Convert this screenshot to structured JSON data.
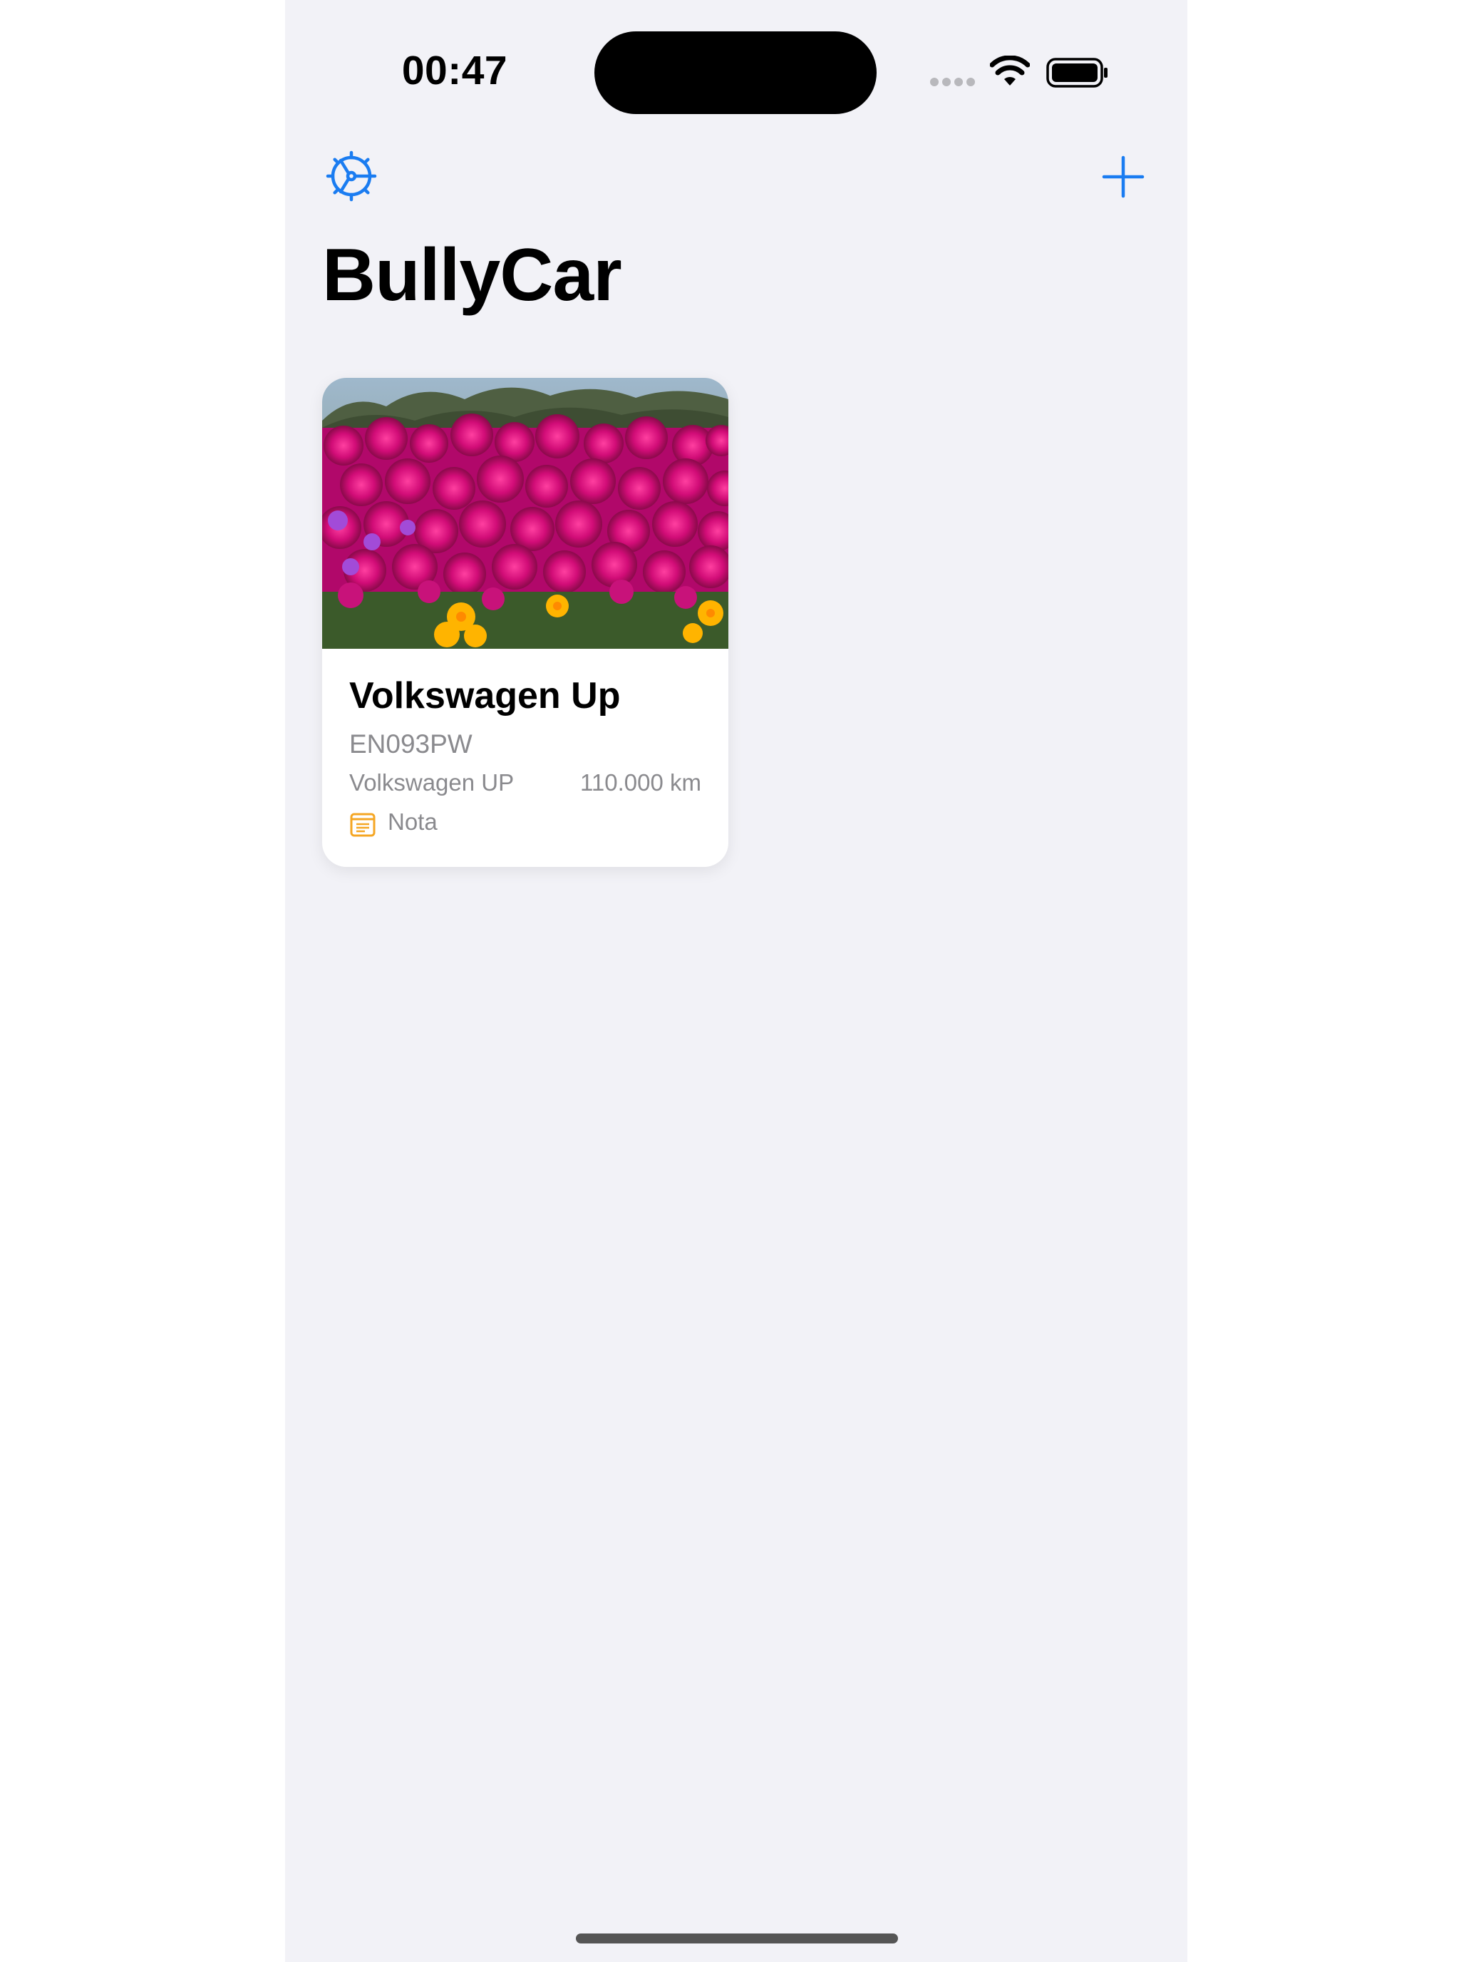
{
  "status_bar": {
    "time": "00:47"
  },
  "nav": {
    "settings_icon": "gear-steering-wheel-icon",
    "add_icon": "plus-icon",
    "title": "BullyCar"
  },
  "colors": {
    "accent": "#1a7cf1",
    "background": "#f2f2f7",
    "secondary_text": "#8a8a8e",
    "note_icon": "#f5a623"
  },
  "cars": [
    {
      "name": "Volkswagen Up",
      "plate": "EN093PW",
      "model": "Volkswagen UP",
      "mileage": "110.000 km",
      "note_label": "Nota",
      "photo": "flower-field-photo"
    }
  ]
}
